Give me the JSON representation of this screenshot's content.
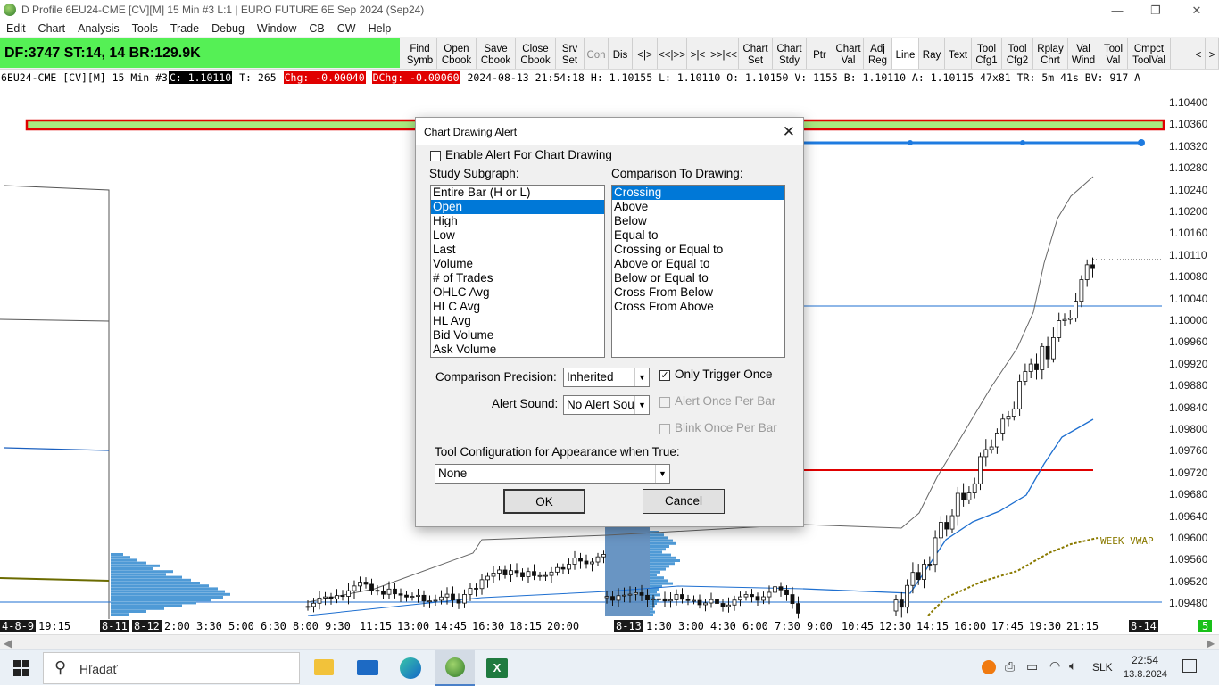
{
  "window": {
    "title": "D Profile 6EU24-CME [CV][M]  15 Min  #3 L:1 | EURO FUTURE 6E Sep 2024 (Sep24)",
    "minimize": "—",
    "restore": "❐",
    "close": "✕"
  },
  "menu": [
    "Edit",
    "Chart",
    "Analysis",
    "Tools",
    "Trade",
    "Debug",
    "Window",
    "CB",
    "CW",
    "Help"
  ],
  "dfpanel": {
    "text": "DF:3747  ST:14, 14  BR:129.9K"
  },
  "toolbar": [
    {
      "label": "Find\nSymb"
    },
    {
      "label": "Open\nCbook"
    },
    {
      "label": "Save\nCbook"
    },
    {
      "label": "Close\nCbook"
    },
    {
      "label": "Srv\nSet"
    },
    {
      "label": "Con"
    },
    {
      "label": "Dis"
    },
    {
      "label": "<|>"
    },
    {
      "label": "<<|>>"
    },
    {
      "label": ">|<"
    },
    {
      "label": ">>|<<"
    },
    {
      "label": "Chart\nSet"
    },
    {
      "label": "Chart\nStdy"
    },
    {
      "label": "Ptr"
    },
    {
      "label": "Chart\nVal"
    },
    {
      "label": "Adj\nReg"
    },
    {
      "label": "Line"
    },
    {
      "label": "Ray"
    },
    {
      "label": "Text"
    },
    {
      "label": "Tool\nCfg1"
    },
    {
      "label": "Tool\nCfg2"
    },
    {
      "label": "Rplay\nChrt"
    },
    {
      "label": "Val\nWind"
    },
    {
      "label": "Tool\nVal"
    },
    {
      "label": "Cmpct\nToolVal"
    },
    {
      "label": "<"
    },
    {
      "label": ">"
    }
  ],
  "infobar": {
    "symbol": "6EU24-CME [CV][M]  15 Min  #3",
    "close": "C: 1.10110",
    "trades": "T: 265",
    "chg": "Chg: -0.00040",
    "dchg": "DChg: -0.00060",
    "rest": "2024-08-13 21:54:18 H: 1.10155 L: 1.10110 O: 1.10150 V: 1155 B: 1.10110 A: 1.10115 47x81 TR: 5m 41s BV: 917 A"
  },
  "price_axis": [
    "1.10400",
    "1.10360",
    "1.10320",
    "1.10280",
    "1.10240",
    "1.10200",
    "1.10160",
    "1.10110",
    "1.10080",
    "1.10040",
    "1.10000",
    "1.09960",
    "1.09920",
    "1.09880",
    "1.09840",
    "1.09800",
    "1.09760",
    "1.09720",
    "1.09680",
    "1.09640",
    "1.09600",
    "1.09560",
    "1.09520",
    "1.09480"
  ],
  "week_vwap_label": "WEEK VWAP",
  "time_axis": [
    "4-8-9",
    "19:15",
    "8-11",
    "8-12",
    "2:00",
    "3:30",
    "5:00",
    "6:30",
    "8:00",
    "9:30",
    "11:15",
    "13:00",
    "14:45",
    "16:30",
    "18:15",
    "20:00",
    "8-13",
    "1:30",
    "3:00",
    "4:30",
    "6:00",
    "7:30",
    "9:00",
    "10:45",
    "12:30",
    "14:15",
    "16:00",
    "17:45",
    "19:30",
    "21:15",
    "8-14",
    "5"
  ],
  "dialog": {
    "title": "Chart Drawing Alert",
    "enable_label": "Enable Alert For Chart Drawing",
    "enable_checked": false,
    "study_label": "Study Subgraph:",
    "study_items": [
      "Entire Bar (H or L)",
      "Open",
      "High",
      "Low",
      "Last",
      "Volume",
      "# of Trades",
      "OHLC Avg",
      "HLC Avg",
      "HL Avg",
      "Bid Volume",
      "Ask Volume"
    ],
    "study_selected": "Open",
    "comparison_label": "Comparison To Drawing:",
    "comparison_items": [
      "Crossing",
      "Above",
      "Below",
      "Equal to",
      "Crossing or Equal to",
      "Above or Equal to",
      "Below or Equal to",
      "Cross From Below",
      "Cross From Above"
    ],
    "comparison_selected": "Crossing",
    "precision_label": "Comparison Precision:",
    "precision_value": "Inherited",
    "only_trigger_label": "Only Trigger Once",
    "only_trigger_checked": true,
    "sound_label": "Alert Sound:",
    "sound_value": "No Alert Sou",
    "alert_once_label": "Alert Once Per Bar",
    "blink_once_label": "Blink Once Per Bar",
    "tool_config_label": "Tool Configuration for Appearance when True:",
    "tool_config_value": "None",
    "ok": "OK",
    "cancel": "Cancel"
  },
  "taskbar": {
    "search_placeholder": "Hľadať",
    "lang": "SLK",
    "time": "22:54",
    "date": "13.8.2024"
  },
  "colors": {
    "accent": "#0078d7",
    "df_green": "#55f055",
    "alert_red": "#e00000",
    "vwap": "#8a7a00",
    "blue_line": "#1e6fd0"
  }
}
